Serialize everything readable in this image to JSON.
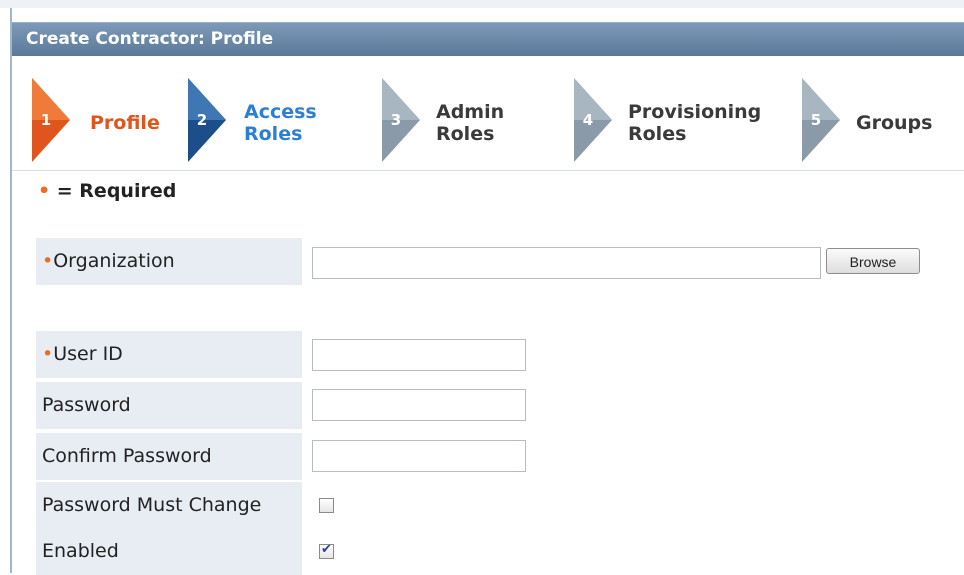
{
  "header": {
    "title": "Create Contractor: Profile"
  },
  "wizard": {
    "steps": [
      {
        "num": "1",
        "label": "Profile",
        "state": "current",
        "arrow_color": "#e0551e",
        "label_color": "#e0551e"
      },
      {
        "num": "2",
        "label": "Access\nRoles",
        "state": "next",
        "arrow_color": "#1c4f8a",
        "label_color": "#2c7fd6"
      },
      {
        "num": "3",
        "label": "Admin\nRoles",
        "state": "inactive",
        "arrow_color": "#8a9aa8",
        "label_color": "#3a3a3a"
      },
      {
        "num": "4",
        "label": "Provisioning\nRoles",
        "state": "inactive",
        "arrow_color": "#8a9aa8",
        "label_color": "#3a3a3a"
      },
      {
        "num": "5",
        "label": "Groups",
        "state": "inactive",
        "arrow_color": "#8a9aa8",
        "label_color": "#3a3a3a"
      }
    ]
  },
  "required_note": {
    "marker": "•",
    "text": " = Required"
  },
  "form": {
    "organization": {
      "marker": "•",
      "label": "Organization",
      "value": "",
      "browse_label": "Browse"
    },
    "user_id": {
      "marker": "•",
      "label": "User ID",
      "value": ""
    },
    "password": {
      "label": "Password",
      "value": ""
    },
    "confirm_password": {
      "label": "Confirm Password",
      "value": ""
    },
    "password_must_change": {
      "label": "Password Must Change",
      "checked": false
    },
    "enabled": {
      "label": "Enabled",
      "checked": true
    }
  },
  "colors": {
    "header_bg": "#6b88a8",
    "required_dot": "#ef6c1c",
    "label_bg": "#e8edf3"
  }
}
